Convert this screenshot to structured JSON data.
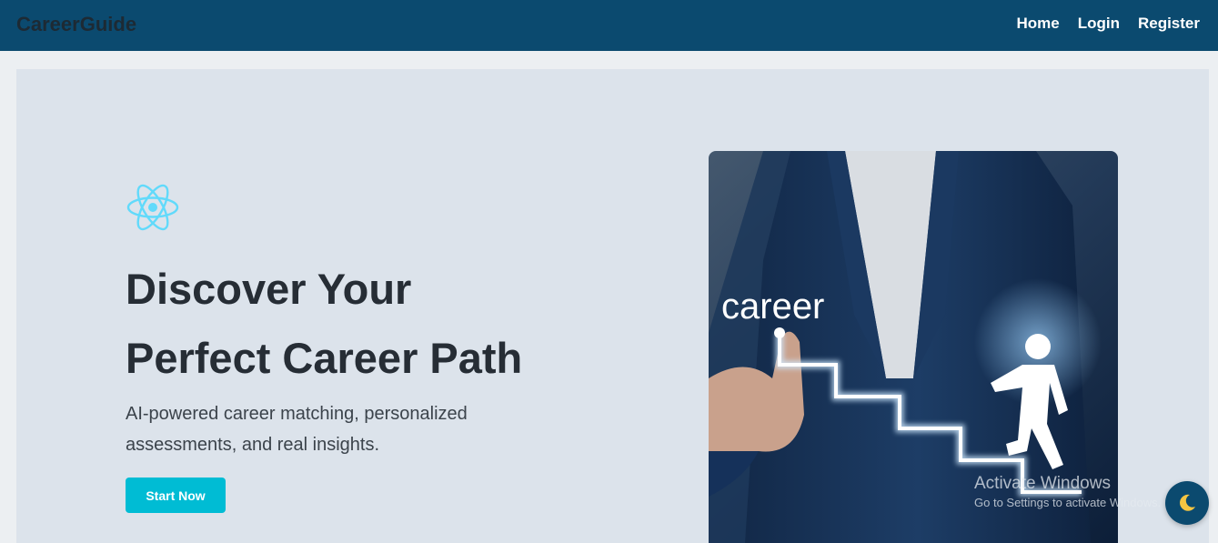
{
  "navbar": {
    "brand": "CareerGuide",
    "links": [
      "Home",
      "Login",
      "Register"
    ]
  },
  "hero": {
    "headline_line1": "Discover Your",
    "headline_line2": "Perfect Career Path",
    "subtitle": "AI-powered career matching, personalized assessments, and real insights.",
    "cta_label": "Start Now",
    "image_text": "career",
    "icon": "react-atom-icon"
  },
  "watermark": {
    "title": "Activate Windows",
    "subtitle": "Go to Settings to activate Windows."
  },
  "theme_toggle": {
    "icon": "moon-icon"
  },
  "colors": {
    "navbar": "#0b4a6f",
    "hero_bg": "#dce3eb",
    "accent": "#00bcd4",
    "react_icon": "#61dafb",
    "heading": "#262d35"
  }
}
